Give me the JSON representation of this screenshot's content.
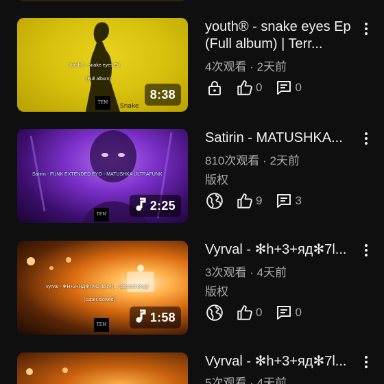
{
  "videos": [
    {
      "title": "youth® - snake eyes Ep (Full album) | Terr...",
      "views": "4次观看",
      "age": "2天前",
      "duration": "8:38",
      "visibility": "lock-icon",
      "likes": "0",
      "comments": "0",
      "thumb_text_1": "Youth® - snake eyes Ep",
      "thumb_text_2": "(Full album)",
      "thumb_extra": "Snake",
      "label_logo": "TEM"
    },
    {
      "title": "Satirin - MATUSHKA...",
      "views": "810次观看",
      "age": "2天前",
      "copyright": "版权",
      "duration": "2:25",
      "visibility": "globe-icon",
      "likes": "9",
      "comments": "3",
      "thumb_text_1": "Satirin - FUNK EXTENDED EYO - MATUSHKA ULTRAFUNK",
      "label_logo": "TEM"
    },
    {
      "title": "Vyrval - ✻h+3+яд✻7l...",
      "views": "3次观看",
      "age": "4天前",
      "copyright": "版权",
      "duration": "1:58",
      "visibility": "globe-icon",
      "likes": "0",
      "comments": "0",
      "thumb_text_1": "vyrval - ✻H+3+ЯД✻7lчС (loli 4)... (second drop)",
      "thumb_text_2": "(super slowed)",
      "label_logo": "TEM"
    },
    {
      "title": "Vyrval - ✻h+3+яд✻7l...",
      "views": "5次观看",
      "age": "4天前"
    }
  ],
  "separator": "·",
  "colors": {
    "bg": "#0f0f0f",
    "text": "#f1f1f1",
    "muted": "#aaaaaa"
  }
}
